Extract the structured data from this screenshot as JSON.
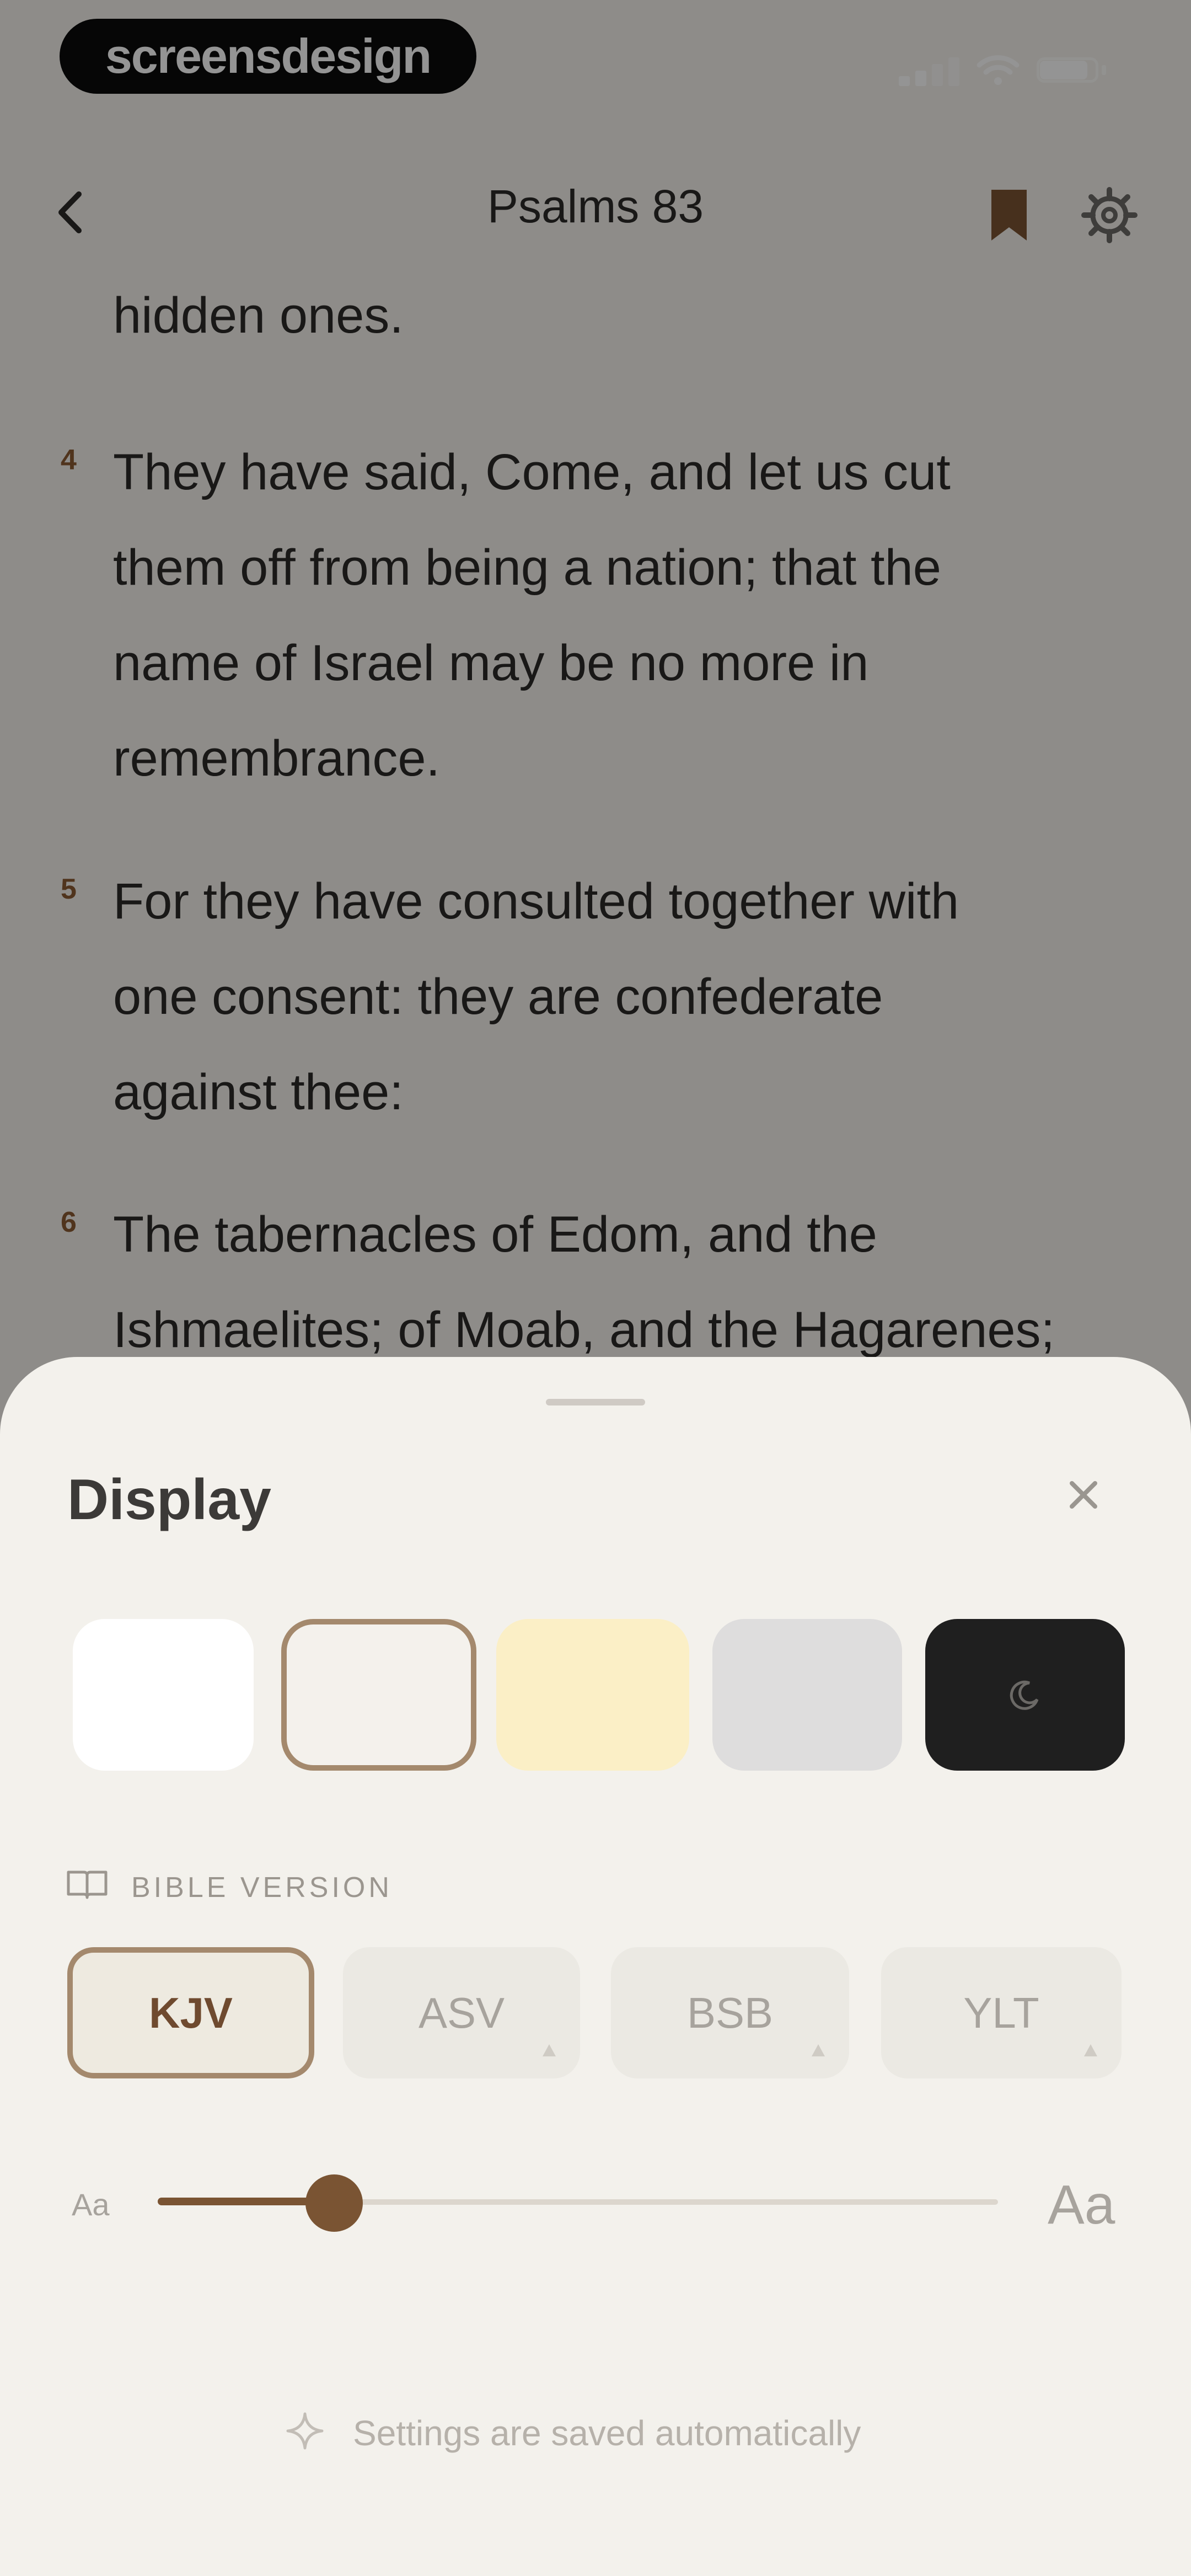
{
  "brand": {
    "label": "screensdesign"
  },
  "reader": {
    "title": "Psalms 83",
    "fragment": "hidden ones.",
    "verses": [
      {
        "number": "4",
        "lines": [
          "They have said, Come, and let us cut",
          "them off from being a nation; that the",
          "name of Israel may be no more in",
          "remembrance."
        ]
      },
      {
        "number": "5",
        "lines": [
          "For they have consulted together with",
          "one consent: they are confederate",
          "against thee:"
        ]
      },
      {
        "number": "6",
        "lines": [
          "The tabernacles of Edom, and the",
          "Ishmaelites; of Moab, and the Hagarenes;"
        ]
      }
    ]
  },
  "sheet": {
    "title": "Display",
    "themes": [
      {
        "name": "white",
        "color": "#ffffff"
      },
      {
        "name": "cream",
        "color": "#f4f1ec",
        "selected": true
      },
      {
        "name": "sepia",
        "color": "#fbefc6"
      },
      {
        "name": "gray",
        "color": "#dedddd"
      },
      {
        "name": "dark",
        "color": "#1f1f1f"
      }
    ],
    "version_label": "BIBLE VERSION",
    "versions": [
      {
        "label": "KJV",
        "selected": true,
        "locked": false
      },
      {
        "label": "ASV",
        "selected": false,
        "locked": true
      },
      {
        "label": "BSB",
        "selected": false,
        "locked": true
      },
      {
        "label": "YLT",
        "selected": false,
        "locked": true
      }
    ],
    "font_size": {
      "small_label": "Aa",
      "large_label": "Aa",
      "level": 0.21
    },
    "saved_note": "Settings are saved automatically"
  },
  "colors": {
    "accent": "#7a5433",
    "accent_border": "#a4896d",
    "verse_number": "#8a5b33"
  }
}
